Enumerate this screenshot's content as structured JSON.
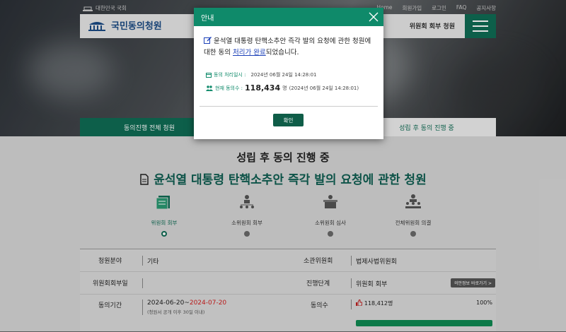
{
  "topbar": {
    "gov_label": "대한민국 국회",
    "links": [
      "Home",
      "회원가입",
      "로그인",
      "FAQ",
      "공지사항"
    ]
  },
  "header": {
    "logo_text": "국민동의청원",
    "right_label": "위원회 회부 청원"
  },
  "tabs": {
    "all": "동의진행 전체 청원",
    "after": "성립 후 동의 진행 중"
  },
  "section_title": "성립 후 동의 진행 중",
  "petition_title": "윤석열 대통령 탄핵소추안 즉각 발의 요청에 관한 청원",
  "steps": [
    {
      "label": "위원회 회부",
      "icon": "documents-icon",
      "active": true
    },
    {
      "label": "소위원회 회부",
      "icon": "org-chart-icon",
      "active": false
    },
    {
      "label": "소위원회 심사",
      "icon": "podium-icon",
      "active": false
    },
    {
      "label": "전체위원회 의결",
      "icon": "meeting-icon",
      "active": false
    }
  ],
  "table": {
    "field_label": "청원분야",
    "field_value": "기타",
    "committee_label": "소관위원회",
    "committee_value": "법제사법위원회",
    "referral_date_label": "위원회회부일",
    "referral_date_value": "",
    "stage_label": "진행단계",
    "stage_value": "위원회 회부",
    "shortcut_button": "의안정보 바로가기 >",
    "period_label": "동의기간",
    "period_start": "2024-06-20",
    "period_sep": "~",
    "period_end": "2024-07-20",
    "period_note": "(청원서 공개 이후 30일 이내)",
    "count_label": "동의수",
    "count_value": "118,412명",
    "count_percent": "100%"
  },
  "modal": {
    "title": "안내",
    "msg_part1": "윤석열 대통령 탄핵소추안 즉각 발의 요청에 관한 청원에 대한 동의",
    "msg_link": "처리가 완료",
    "msg_part2": "되었습니다.",
    "time_label": "동의 처리일시 :",
    "time_value": "2024년 06월 24일 14:28:01",
    "count_label": "현재 동의수 :",
    "count_value": "118,434",
    "count_unit": "명",
    "count_time": "(2024년 06월 24일 14:28:01)",
    "confirm_button": "확인"
  },
  "colors": {
    "brand_green": "#0f6d55",
    "modal_header": "#0f8a6a",
    "link_blue": "#1a3fb8",
    "date_red": "#d32020",
    "progress_green": "#0f8a52"
  },
  "progress_fraction": 1.0
}
